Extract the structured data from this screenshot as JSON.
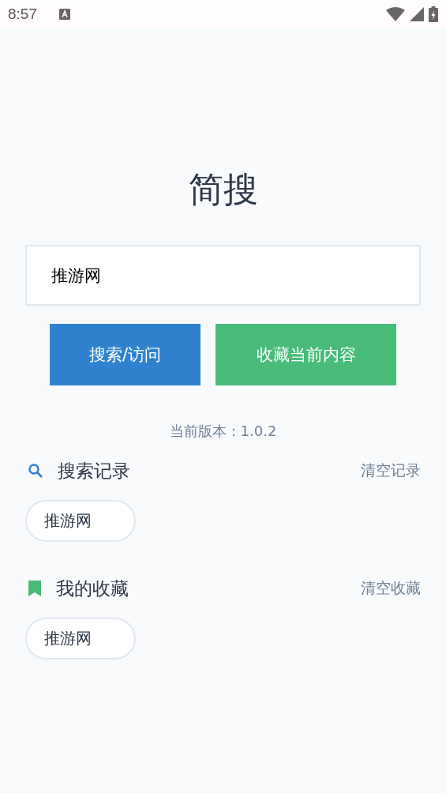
{
  "status_bar": {
    "time": "8:57"
  },
  "title": "简搜",
  "search": {
    "value": "推游网"
  },
  "buttons": [
    {
      "label": "搜索/访问",
      "kind": "primary"
    },
    {
      "label": "收藏当前内容",
      "kind": "success"
    }
  ],
  "version": "当前版本：1.0.2",
  "sections": [
    {
      "kind": "history",
      "title": "搜索记录",
      "action": "清空记录",
      "chips": [
        "推游网"
      ]
    },
    {
      "kind": "favorites",
      "title": "我的收藏",
      "action": "清空收藏",
      "chips": [
        "推游网"
      ]
    }
  ]
}
